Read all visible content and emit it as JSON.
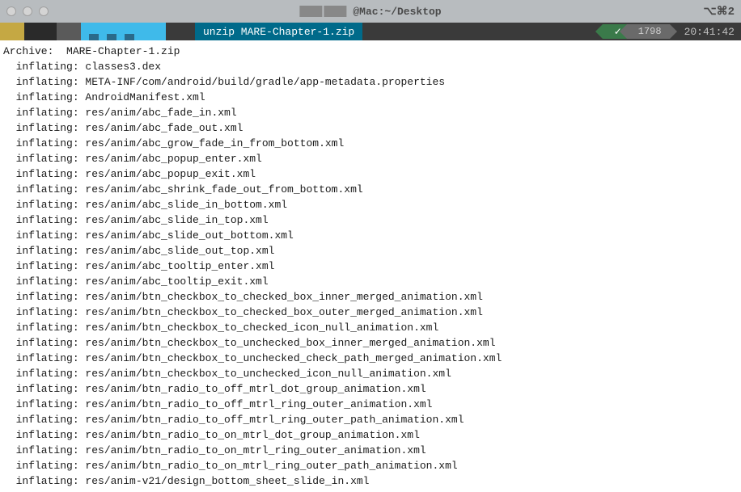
{
  "titlebar": {
    "host": "@Mac:",
    "path": "~/Desktop",
    "right": "⌥⌘2"
  },
  "statusbar": {
    "command": "unzip MARE-Chapter-1.zip",
    "check": "✓",
    "number": "1798",
    "time": "20:41:42"
  },
  "output": {
    "archive_label": "Archive:",
    "archive_name": "MARE-Chapter-1.zip",
    "prefix": "inflating:",
    "files": [
      "classes3.dex",
      "META-INF/com/android/build/gradle/app-metadata.properties",
      "AndroidManifest.xml",
      "res/anim/abc_fade_in.xml",
      "res/anim/abc_fade_out.xml",
      "res/anim/abc_grow_fade_in_from_bottom.xml",
      "res/anim/abc_popup_enter.xml",
      "res/anim/abc_popup_exit.xml",
      "res/anim/abc_shrink_fade_out_from_bottom.xml",
      "res/anim/abc_slide_in_bottom.xml",
      "res/anim/abc_slide_in_top.xml",
      "res/anim/abc_slide_out_bottom.xml",
      "res/anim/abc_slide_out_top.xml",
      "res/anim/abc_tooltip_enter.xml",
      "res/anim/abc_tooltip_exit.xml",
      "res/anim/btn_checkbox_to_checked_box_inner_merged_animation.xml",
      "res/anim/btn_checkbox_to_checked_box_outer_merged_animation.xml",
      "res/anim/btn_checkbox_to_checked_icon_null_animation.xml",
      "res/anim/btn_checkbox_to_unchecked_box_inner_merged_animation.xml",
      "res/anim/btn_checkbox_to_unchecked_check_path_merged_animation.xml",
      "res/anim/btn_checkbox_to_unchecked_icon_null_animation.xml",
      "res/anim/btn_radio_to_off_mtrl_dot_group_animation.xml",
      "res/anim/btn_radio_to_off_mtrl_ring_outer_animation.xml",
      "res/anim/btn_radio_to_off_mtrl_ring_outer_path_animation.xml",
      "res/anim/btn_radio_to_on_mtrl_dot_group_animation.xml",
      "res/anim/btn_radio_to_on_mtrl_ring_outer_animation.xml",
      "res/anim/btn_radio_to_on_mtrl_ring_outer_path_animation.xml",
      "res/anim-v21/design_bottom_sheet_slide_in.xml"
    ]
  }
}
